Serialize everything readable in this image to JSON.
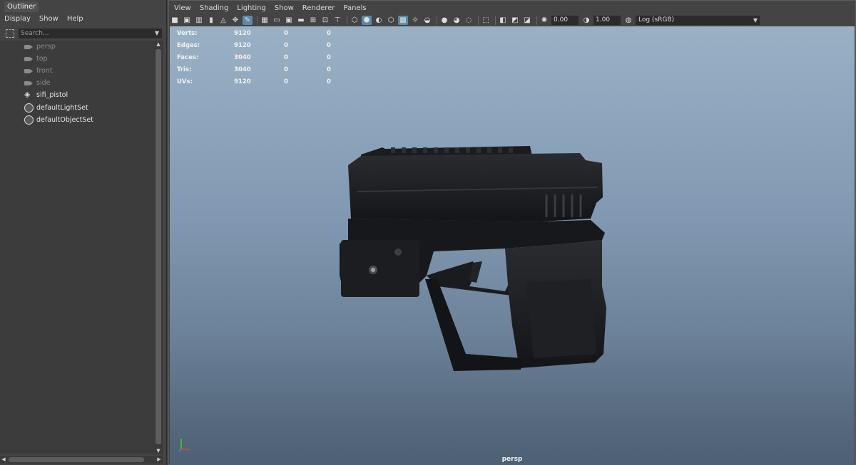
{
  "outliner": {
    "tab_title": "Outliner",
    "menu": [
      "Display",
      "Show",
      "Help"
    ],
    "search_placeholder": "Search...",
    "items": [
      {
        "label": "persp",
        "icon": "camera-icon",
        "dimmed": true
      },
      {
        "label": "top",
        "icon": "camera-icon",
        "dimmed": true
      },
      {
        "label": "front",
        "icon": "camera-icon",
        "dimmed": true
      },
      {
        "label": "side",
        "icon": "camera-icon",
        "dimmed": true
      },
      {
        "label": "sifi_pistol",
        "icon": "mesh-icon",
        "dimmed": false
      },
      {
        "label": "defaultLightSet",
        "icon": "set-icon",
        "dimmed": false
      },
      {
        "label": "defaultObjectSet",
        "icon": "set-icon",
        "dimmed": false
      }
    ]
  },
  "viewport": {
    "menu": [
      "View",
      "Shading",
      "Lighting",
      "Show",
      "Renderer",
      "Panels"
    ],
    "exposure_value": "0.00",
    "gamma_value": "1.00",
    "color_space": "Log (sRGB)",
    "camera_name": "persp",
    "hud": [
      {
        "label": "Verts:",
        "values": [
          "9120",
          "0",
          "0"
        ]
      },
      {
        "label": "Edges:",
        "values": [
          "9120",
          "0",
          "0"
        ]
      },
      {
        "label": "Faces:",
        "values": [
          "3040",
          "0",
          "0"
        ]
      },
      {
        "label": "Tris:",
        "values": [
          "3040",
          "0",
          "0"
        ]
      },
      {
        "label": "UVs:",
        "values": [
          "9120",
          "0",
          "0"
        ]
      }
    ]
  },
  "colors": {
    "ui_background": "#444444",
    "viewport_gradient_top": "#9ab0c4",
    "viewport_gradient_bottom": "#4e6073",
    "active_button": "#5a8aa8"
  }
}
